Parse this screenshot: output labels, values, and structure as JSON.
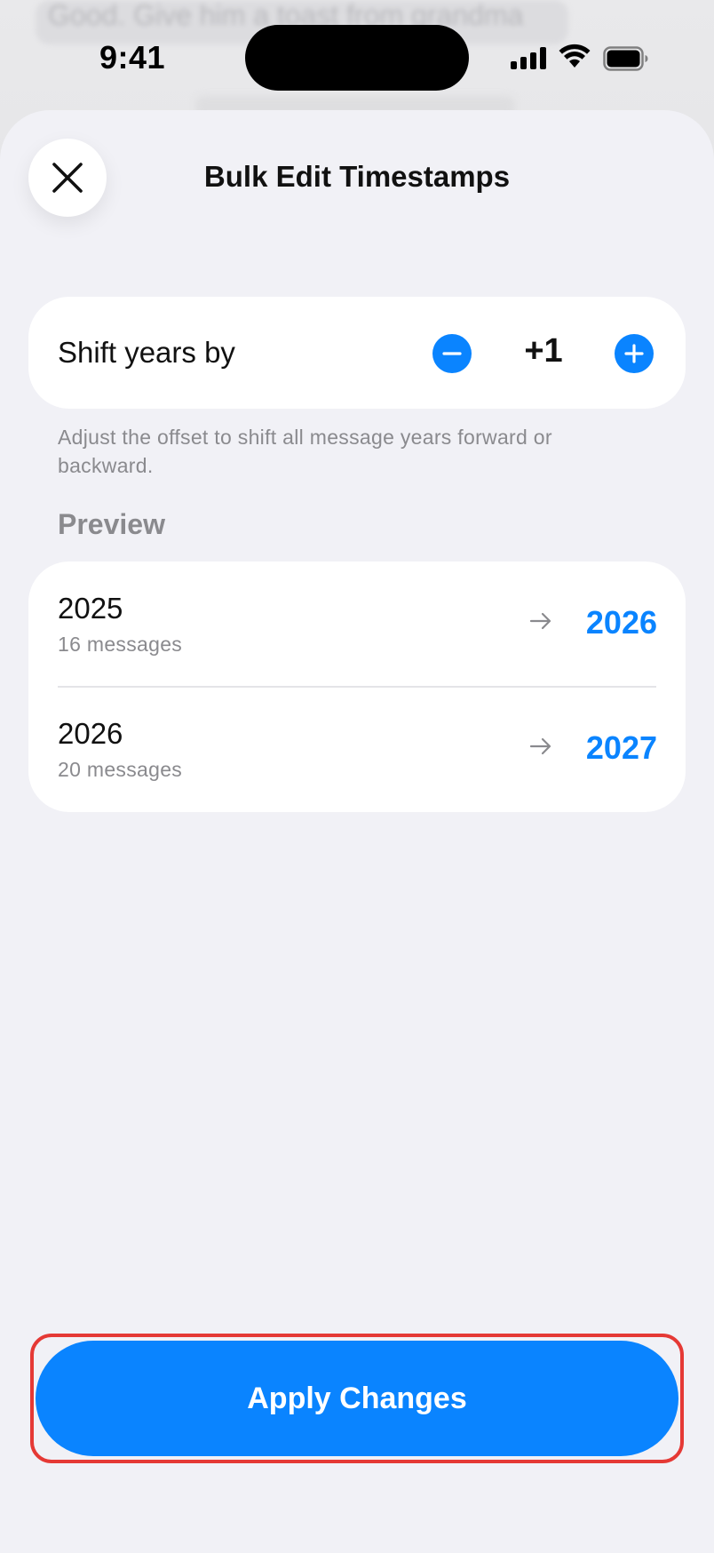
{
  "backdrop": {
    "message_text": "Good. Give him a toast from grandma"
  },
  "status_bar": {
    "time": "9:41"
  },
  "sheet": {
    "title": "Bulk Edit Timestamps",
    "close_icon": "close-icon"
  },
  "shift": {
    "label": "Shift years by",
    "value": "+1",
    "minus_icon": "minus-icon",
    "plus_icon": "plus-icon",
    "helper": "Adjust the offset to shift all message years forward or backward."
  },
  "preview": {
    "header": "Preview",
    "rows": [
      {
        "from": "2025",
        "count": "16 messages",
        "to": "2026"
      },
      {
        "from": "2026",
        "count": "20 messages",
        "to": "2027"
      }
    ]
  },
  "actions": {
    "apply_label": "Apply Changes"
  },
  "colors": {
    "accent": "#0a84ff",
    "sheet_bg": "#f1f1f6",
    "secondary_text": "#8a8a8e",
    "highlight": "#e53935"
  }
}
